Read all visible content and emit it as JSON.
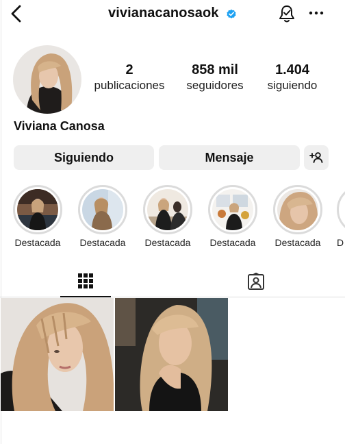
{
  "header": {
    "username": "vivianacanosaok",
    "back_icon": "chevron-left-icon",
    "verified_icon": "verified-badge-icon",
    "bell_icon": "notification-bell-icon",
    "more_icon": "more-horizontal-icon",
    "verified_color": "#0095f6"
  },
  "profile": {
    "display_name": "Viviana Canosa",
    "avatar": "profile-photo"
  },
  "stats": {
    "posts": {
      "value": "2",
      "label": "publicaciones"
    },
    "followers": {
      "value": "858 mil",
      "label": "seguidores"
    },
    "following": {
      "value": "1.404",
      "label": "siguiendo"
    }
  },
  "actions": {
    "following_label": "Siguiendo",
    "message_label": "Mensaje",
    "suggest_icon": "add-person-icon"
  },
  "highlights": [
    {
      "label": "Destacada"
    },
    {
      "label": "Destacada"
    },
    {
      "label": "Destacada"
    },
    {
      "label": "Destacada"
    },
    {
      "label": "Destacada"
    },
    {
      "label": "D"
    }
  ],
  "tabs": [
    {
      "icon": "grid-icon",
      "active": true
    },
    {
      "icon": "tagged-person-icon",
      "active": false
    }
  ],
  "posts": [
    {
      "content": "photo-woman-blonde-bangs"
    },
    {
      "content": "photo-woman-black-turtleneck"
    }
  ]
}
